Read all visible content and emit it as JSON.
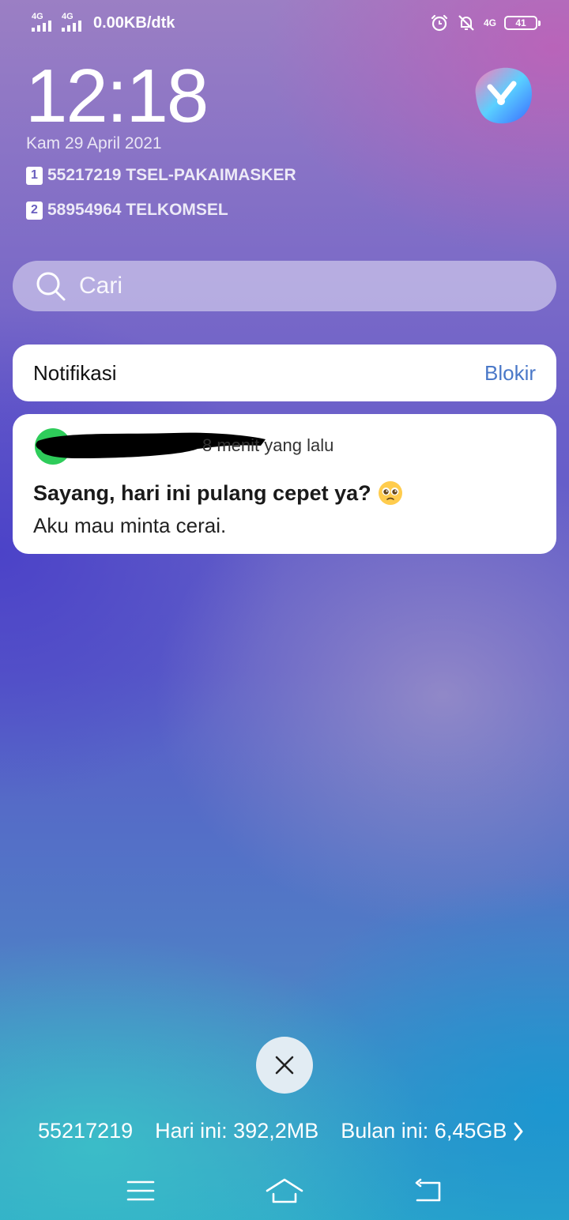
{
  "status_bar": {
    "sim1_network": "4G",
    "sim2_network": "4G",
    "net_speed": "0.00KB/dtk",
    "right_network": "4G",
    "battery_level": "41",
    "icons": [
      "alarm-icon",
      "notifications-off-icon",
      "4g-icon",
      "battery-icon"
    ]
  },
  "lockscreen": {
    "time": "12:18",
    "date": "Kam 29 April 2021",
    "sims": [
      {
        "slot": "1",
        "label": "55217219 TSEL-PAKAIMASKER"
      },
      {
        "slot": "2",
        "label": "58954964 TELKOMSEL"
      }
    ]
  },
  "search": {
    "placeholder": "Cari"
  },
  "notifications_header": {
    "title": "Notifikasi",
    "action": "Blokir"
  },
  "notification": {
    "time": "8 menit yang lalu",
    "title": "Sayang, hari ini pulang cepet ya?",
    "body": "Aku mau minta cerai.",
    "accent_color": "#2ecc5a"
  },
  "data_usage": {
    "number": "55217219",
    "today": "Hari ini: 392,2MB",
    "month": "Bulan ini: 6,45GB"
  },
  "nav": {
    "icons": [
      "menu-icon",
      "home-icon",
      "back-icon"
    ]
  },
  "colors": {
    "accent_link": "#4a78c8"
  }
}
